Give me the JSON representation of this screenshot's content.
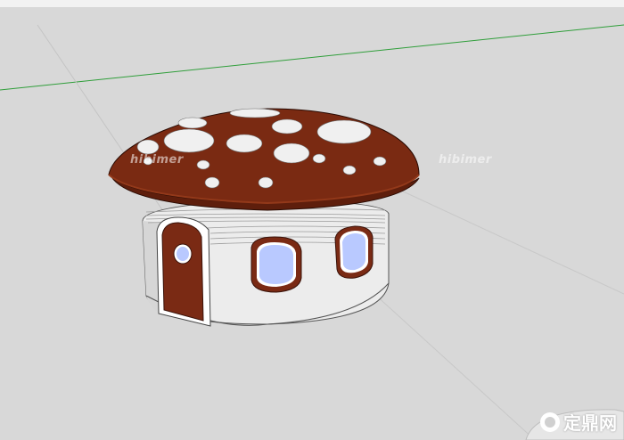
{
  "watermarks": {
    "left": "hibimer",
    "right": "hibimer"
  },
  "brand": {
    "text": "定鼎网",
    "icon": "logo-circle-icon"
  },
  "colors": {
    "background": "#d8d8d8",
    "axis_green": "#2f9e3a",
    "cap": "#7a2a12",
    "cap_light": "#93391a",
    "wall": "#ececec",
    "door": "#7a2a14",
    "window_glass": "#b9c9ff"
  }
}
